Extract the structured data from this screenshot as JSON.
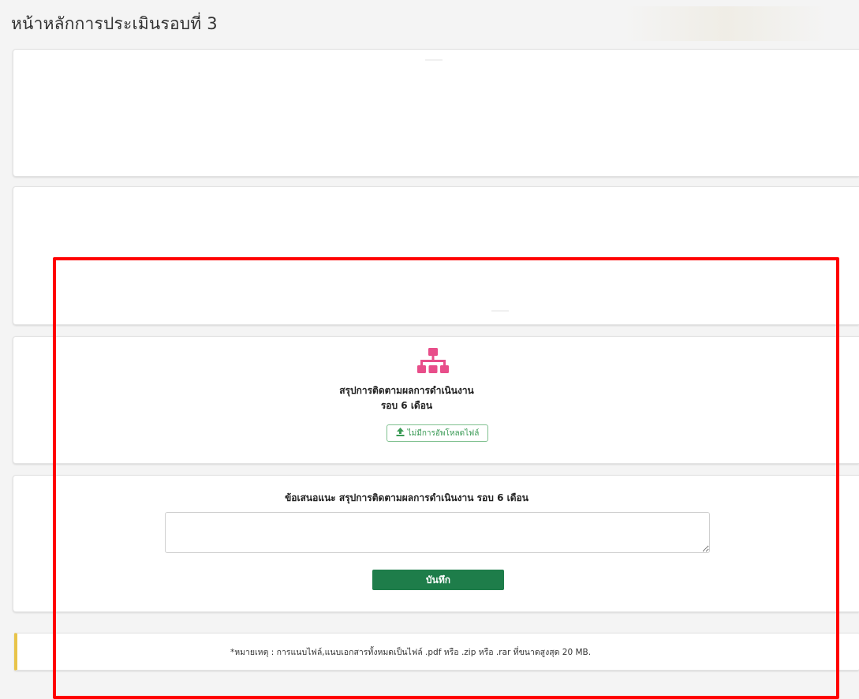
{
  "page": {
    "title": "หน้าหลักการประเมินรอบที่ 3"
  },
  "summary_card": {
    "icon": "sitemap-icon",
    "title": "สรุปการติดตามผลการดำเนินงาน",
    "subtitle": "รอบ 6 เดือน",
    "upload_icon": "upload-icon",
    "upload_label": "ไม่มีการอัพโหลดไฟล์"
  },
  "suggestion_card": {
    "title": "ข้อเสนอแนะ สรุปการติดตามผลการดำเนินงาน รอบ 6 เดือน",
    "input_value": "",
    "save_label": "บันทึก"
  },
  "note": {
    "text": "*หมายเหตุ : การแนบไฟล์,แนบเอกสารทั้งหมดเป็นไฟล์ .pdf หรือ .zip หรือ .rar ที่ขนาดสูงสุด 20 MB."
  },
  "colors": {
    "accent_pink": "#e84e8a",
    "save_green": "#1e7d4a",
    "upload_green": "#3a9a55",
    "highlight_red": "#ff0000",
    "note_border": "#e8c44a"
  }
}
